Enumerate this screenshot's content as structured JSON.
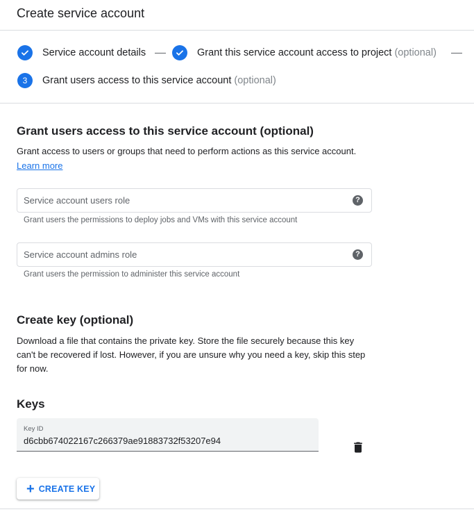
{
  "header": {
    "title": "Create service account"
  },
  "stepper": {
    "steps": [
      {
        "label": "Service account details",
        "optional": "",
        "state": "done"
      },
      {
        "label": "Grant this service account access to project",
        "optional": "(optional)",
        "state": "done"
      },
      {
        "number": "3",
        "label": "Grant users access to this service account",
        "optional": "(optional)",
        "state": "active"
      }
    ]
  },
  "grant_section": {
    "title": "Grant users access to this service account (optional)",
    "description": "Grant access to users or groups that need to perform actions as this service account.",
    "learn_more": "Learn more",
    "users_role": {
      "placeholder": "Service account users role",
      "value": "",
      "hint": "Grant users the permissions to deploy jobs and VMs with this service account"
    },
    "admins_role": {
      "placeholder": "Service account admins role",
      "value": "",
      "hint": "Grant users the permission to administer this service account"
    },
    "help_glyph": "?"
  },
  "key_section": {
    "title": "Create key (optional)",
    "description_lines": [
      "Download a file that contains the private key. Store the file securely because this key",
      "can't be recovered if lost. However, if you are unsure why you need a key, skip this step",
      "for now."
    ]
  },
  "keys": {
    "title": "Keys",
    "key_id_label": "Key ID",
    "key_id_value": "d6cbb674022167c266379ae91883732f53207e94"
  },
  "create_key_button": {
    "icon": "plus-icon",
    "label": "CREATE KEY"
  },
  "colors": {
    "accent": "#1a73e8",
    "text": "#202124",
    "muted": "#5f6368",
    "divider": "#dadce0"
  }
}
